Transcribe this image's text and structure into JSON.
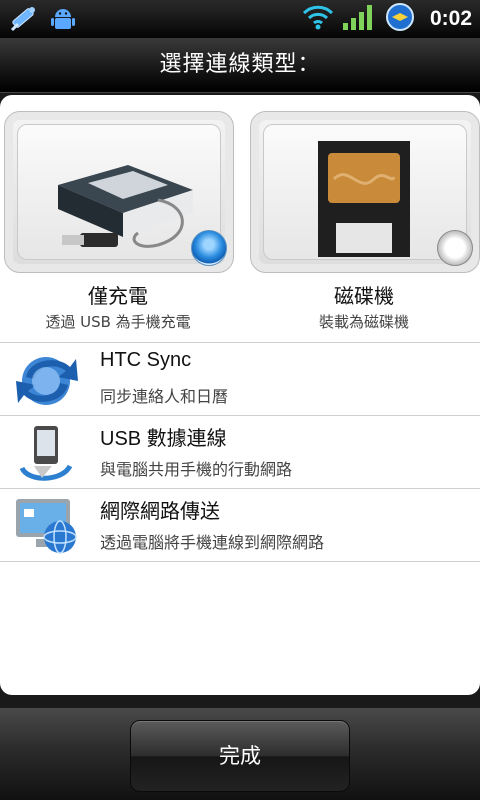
{
  "status_bar": {
    "time": "0:02",
    "icons": [
      "usb-debug-icon",
      "android-icon",
      "wifi-icon",
      "signal-icon",
      "sync-icon"
    ]
  },
  "header": {
    "title": "選擇連線類型："
  },
  "options": [
    {
      "title": "僅充電",
      "subtitle": "透過 USB 為手機充電",
      "selected": true
    },
    {
      "title": "磁碟機",
      "subtitle": "裝載為磁碟機",
      "selected": false
    }
  ],
  "list": [
    {
      "title": "HTC Sync",
      "subtitle": "同步連絡人和日曆",
      "icon": "sync-arrows-icon"
    },
    {
      "title": "USB 數據連線",
      "subtitle": "與電腦共用手機的行動網路",
      "icon": "usb-tether-icon"
    },
    {
      "title": "網際網路傳送",
      "subtitle": "透過電腦將手機連線到網際網路",
      "icon": "internet-pass-through-icon"
    }
  ],
  "footer": {
    "done_label": "完成"
  }
}
